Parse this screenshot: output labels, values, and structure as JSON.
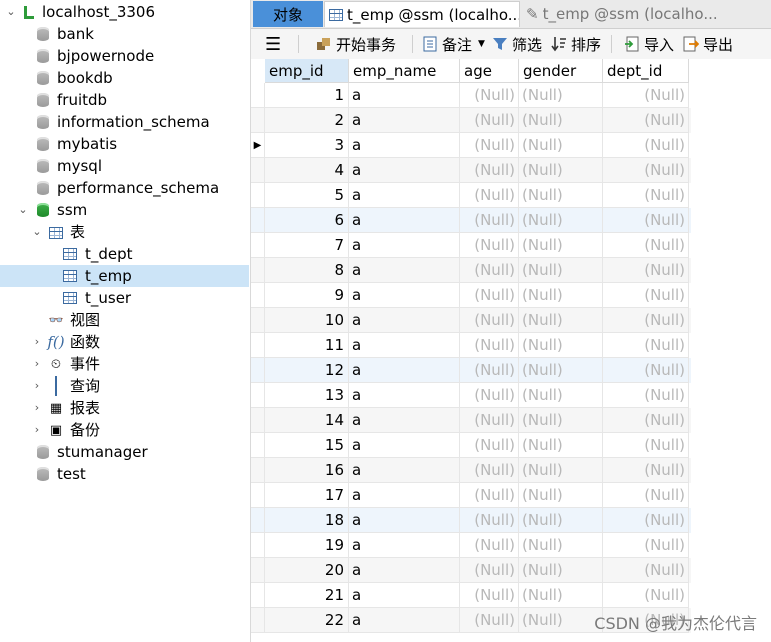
{
  "sidebar": {
    "connection": "localhost_3306",
    "databases": [
      "bank",
      "bjpowernode",
      "bookdb",
      "fruitdb",
      "information_schema",
      "mybatis",
      "mysql",
      "performance_schema"
    ],
    "open_db": "ssm",
    "tables_node": "表",
    "tables": [
      "t_dept",
      "t_emp",
      "t_user"
    ],
    "selected_table": "t_emp",
    "other_nodes": [
      "视图",
      "函数",
      "事件",
      "查询",
      "报表",
      "备份"
    ],
    "databases_after": [
      "stumanager",
      "test"
    ]
  },
  "tabs": {
    "objects": "对象",
    "active": "t_emp @ssm (localho...",
    "inactive": "t_emp @ssm (localho..."
  },
  "toolbar": {
    "begin_tx": "开始事务",
    "memo": "备注",
    "filter": "筛选",
    "sort": "排序",
    "import": "导入",
    "export": "导出"
  },
  "grid": {
    "columns": [
      "emp_id",
      "emp_name",
      "age",
      "gender",
      "dept_id"
    ],
    "null_text": "(Null)",
    "rows": [
      {
        "emp_id": "1",
        "emp_name": "a"
      },
      {
        "emp_id": "2",
        "emp_name": "a"
      },
      {
        "emp_id": "3",
        "emp_name": "a"
      },
      {
        "emp_id": "4",
        "emp_name": "a"
      },
      {
        "emp_id": "5",
        "emp_name": "a"
      },
      {
        "emp_id": "6",
        "emp_name": "a"
      },
      {
        "emp_id": "7",
        "emp_name": "a"
      },
      {
        "emp_id": "8",
        "emp_name": "a"
      },
      {
        "emp_id": "9",
        "emp_name": "a"
      },
      {
        "emp_id": "10",
        "emp_name": "a"
      },
      {
        "emp_id": "11",
        "emp_name": "a"
      },
      {
        "emp_id": "12",
        "emp_name": "a"
      },
      {
        "emp_id": "13",
        "emp_name": "a"
      },
      {
        "emp_id": "14",
        "emp_name": "a"
      },
      {
        "emp_id": "15",
        "emp_name": "a"
      },
      {
        "emp_id": "16",
        "emp_name": "a"
      },
      {
        "emp_id": "17",
        "emp_name": "a"
      },
      {
        "emp_id": "18",
        "emp_name": "a"
      },
      {
        "emp_id": "19",
        "emp_name": "a"
      },
      {
        "emp_id": "20",
        "emp_name": "a"
      },
      {
        "emp_id": "21",
        "emp_name": "a"
      },
      {
        "emp_id": "22",
        "emp_name": "a"
      }
    ]
  },
  "watermark": "CSDN @我为杰伦代言",
  "colors": {
    "accent": "#4a90d9",
    "selection": "#cce4f7",
    "null_text": "#b8b8b8"
  }
}
